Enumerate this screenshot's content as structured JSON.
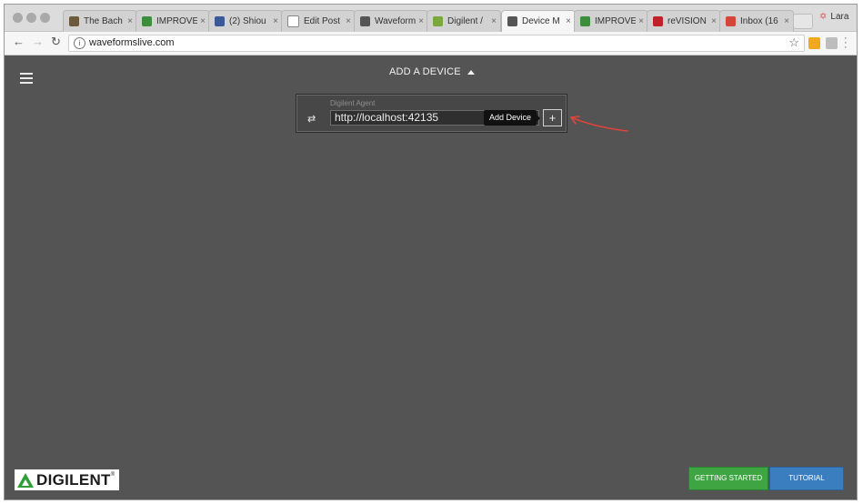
{
  "browser": {
    "tabs": [
      {
        "label": "The Bach",
        "icon": "bachelor-icon",
        "color": "#6b5a3c",
        "active": false
      },
      {
        "label": "IMPROVE",
        "icon": "heart-icon",
        "color": "#3c8d3c",
        "active": false
      },
      {
        "label": "(2) Shiou",
        "icon": "facebook-icon",
        "color": "#3b5998",
        "active": false
      },
      {
        "label": "Edit Post",
        "icon": "page-icon",
        "color": "#ffffff",
        "active": false
      },
      {
        "label": "Waveform",
        "icon": "waveforms-icon",
        "color": "#555555",
        "active": false
      },
      {
        "label": "Digilent /",
        "icon": "digilent-leaf-icon",
        "color": "#7aa83c",
        "active": false
      },
      {
        "label": "Device M",
        "icon": "waveforms-icon",
        "color": "#555555",
        "active": true
      },
      {
        "label": "IMPROVE",
        "icon": "heart-icon",
        "color": "#3c8d3c",
        "active": false
      },
      {
        "label": "reVISION",
        "icon": "xilinx-icon",
        "color": "#c0202a",
        "active": false
      },
      {
        "label": "Inbox (16",
        "icon": "gmail-icon",
        "color": "#d44638",
        "active": false
      }
    ],
    "close_glyph": "×",
    "profile_name": "Lara",
    "url": "waveformslive.com"
  },
  "app": {
    "header_title": "ADD A DEVICE",
    "agent": {
      "label": "Digilent Agent",
      "url_value": "http://localhost:42135",
      "tooltip": "Add Device",
      "add_glyph": "+"
    },
    "logo_text": "DIGILENT",
    "logo_mark": "®",
    "buttons": {
      "getting_started": "GETTING STARTED",
      "tutorial": "TUTORIAL"
    }
  },
  "colors": {
    "app_background": "#545454",
    "getting_started": "#3fa543",
    "tutorial": "#3b7ec0",
    "annotation_arrow": "#e0443a",
    "logo_green": "#2e9e36"
  }
}
